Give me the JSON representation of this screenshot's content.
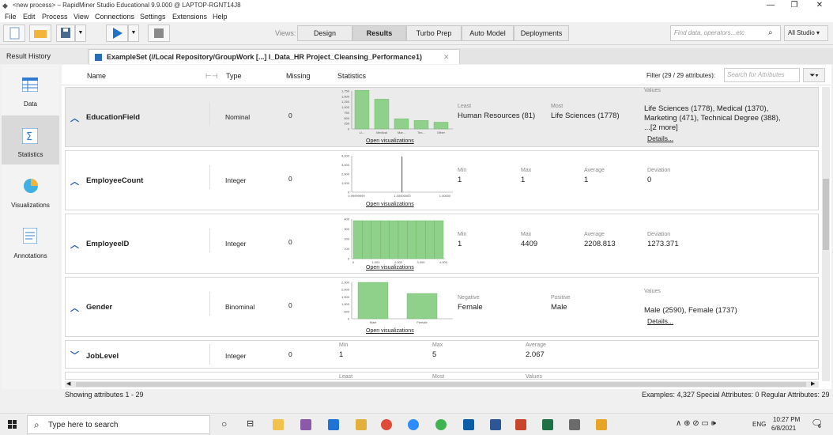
{
  "window": {
    "title": "<new process> – RapidMiner Studio Educational 9.9.000 @ LAPTOP-RGNT14J8"
  },
  "menu": [
    "File",
    "Edit",
    "Process",
    "View",
    "Connections",
    "Settings",
    "Extensions",
    "Help"
  ],
  "toolbar": {
    "views_label": "Views:",
    "views": [
      "Design",
      "Results",
      "Turbo Prep",
      "Auto Model",
      "Deployments"
    ],
    "active_view": "Results",
    "search_placeholder": "Find data, operators...etc",
    "studio_select": "All Studio"
  },
  "tabs": {
    "result_history": "Result History",
    "example_set": "ExampleSet (//Local Repository/GroupWork [...] I_Data_HR Project_Cleansing_Performance1)"
  },
  "leftnav": [
    "Data",
    "Statistics",
    "Visualizations",
    "Annotations"
  ],
  "columns": {
    "name": "Name",
    "type": "Type",
    "missing": "Missing",
    "statistics": "Statistics",
    "filter": "Filter (29 / 29 attributes):",
    "filter_placeholder": "Search for Attributes"
  },
  "open_viz": "Open visualizations",
  "details": "Details...",
  "rows": [
    {
      "name": "EducationField",
      "type": "Nominal",
      "missing": "0",
      "stat1_label": "Least",
      "stat1_value": "Human Resources (81)",
      "stat2_label": "Most",
      "stat2_value": "Life Sciences (1778)",
      "values_label": "Values",
      "values_lines": [
        "Life Sciences (1778), Medical (1370),",
        "Marketing (471), Technical Degree (388),",
        "...[2 more]"
      ],
      "chart": {
        "type": "bar",
        "categories": [
          "Li...",
          "Medical",
          "Mar...",
          "Tec...",
          "Other"
        ],
        "values": [
          1778,
          1370,
          471,
          388,
          310
        ],
        "ylim": [
          0,
          1750
        ],
        "yticks": [
          "1,750",
          "1,500",
          "1,250",
          "1,000",
          "750",
          "500",
          "250",
          "0"
        ]
      }
    },
    {
      "name": "EmployeeCount",
      "type": "Integer",
      "missing": "0",
      "stat1_label": "Min",
      "stat1_value": "1",
      "stat2_label": "Max",
      "stat2_value": "1",
      "stat3_label": "Average",
      "stat3_value": "1",
      "stat4_label": "Deviation",
      "stat4_value": "0",
      "chart": {
        "type": "bar",
        "xticks": [
          "0.99999999",
          "1.00000000",
          "1.00000"
        ],
        "yticks": [
          "4,000",
          "3,000",
          "2,000",
          "1,000",
          "0"
        ],
        "ylim": [
          0,
          4400
        ],
        "spike_value": 4327
      }
    },
    {
      "name": "EmployeeID",
      "type": "Integer",
      "missing": "0",
      "stat1_label": "Min",
      "stat1_value": "1",
      "stat2_label": "Max",
      "stat2_value": "4409",
      "stat3_label": "Average",
      "stat3_value": "2208.813",
      "stat4_label": "Deviation",
      "stat4_value": "1273.371",
      "chart": {
        "type": "bar",
        "values": [
          432,
          432,
          432,
          432,
          432,
          432,
          432,
          432,
          432,
          432
        ],
        "ylim": [
          0,
          450
        ],
        "xticks": [
          "0",
          "1,000",
          "2,000",
          "3,000",
          "4,000"
        ],
        "yticks": [
          "400",
          "300",
          "200",
          "100",
          "0"
        ]
      }
    },
    {
      "name": "Gender",
      "type": "Binominal",
      "missing": "0",
      "stat1_label": "Negative",
      "stat1_value": "Female",
      "stat2_label": "Positive",
      "stat2_value": "Male",
      "values_label": "Values",
      "values_lines": [
        "Male (2590), Female (1737)"
      ],
      "chart": {
        "type": "bar",
        "categories": [
          "Male",
          "Female"
        ],
        "values": [
          2590,
          1737
        ],
        "ylim": [
          0,
          2500
        ],
        "yticks": [
          "2,500",
          "2,000",
          "1,500",
          "1,000",
          "500",
          "0"
        ]
      }
    },
    {
      "name": "JobLevel",
      "type": "Integer",
      "missing": "0",
      "stat1_label": "Min",
      "stat1_value": "1",
      "stat2_label": "Max",
      "stat2_value": "5",
      "stat3_label": "Average",
      "stat3_value": "2.067"
    },
    {
      "stat1_label": "Least",
      "stat2_label": "Most",
      "values_label": "Values"
    }
  ],
  "status": {
    "showing": "Showing attributes 1 - 29",
    "examples": "Examples: 4,327",
    "special": "Special Attributes: 0",
    "regular": "Regular Attributes: 29"
  },
  "taskbar": {
    "search": "Type here to search",
    "lang": "ENG",
    "time": "10:27 PM",
    "date": "6/8/2021",
    "notif": "6"
  }
}
